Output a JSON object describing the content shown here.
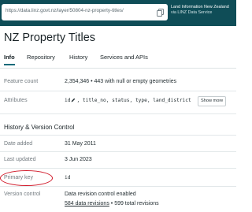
{
  "browser": {
    "url": "https://data.linz.govt.nz/layer/50804-nz-property-titles/",
    "agency_line1": "Land Information New Zealand",
    "agency_line2": "via LINZ Data Service",
    "copy_icon": "copy-icon"
  },
  "page": {
    "title": "NZ Property Titles"
  },
  "tabs": [
    {
      "label": "Info",
      "active": true
    },
    {
      "label": "Repository",
      "active": false
    },
    {
      "label": "History",
      "active": false
    },
    {
      "label": "Services and APIs",
      "active": false
    }
  ],
  "details": {
    "feature_count_label": "Feature count",
    "feature_count_value": "2,354,346",
    "feature_count_bullet": "•",
    "feature_count_note": "443 with null or empty geometries",
    "attributes_label": "Attributes",
    "attributes_first": "id",
    "attributes_rest": ", title_no, status, type, land_district",
    "show_more_label": "Show more"
  },
  "history": {
    "section_title": "History & Version Control",
    "date_added_label": "Date added",
    "date_added_value": "31 May 2011",
    "last_updated_label": "Last updated",
    "last_updated_value": "3 Jun 2023",
    "primary_key_label": "Primary key",
    "primary_key_value": "id",
    "version_control_label": "Version control",
    "version_control_value": "Data revision control enabled",
    "data_revisions_link": "584 data revisions",
    "revisions_bullet": "•",
    "total_revisions": "599 total revisions"
  },
  "annotation": {
    "highlight_color": "#d11a2a",
    "highlighted_field": "Primary key"
  },
  "colors": {
    "header_bg": "#0f4d57",
    "accent": "#0f6b7a"
  }
}
